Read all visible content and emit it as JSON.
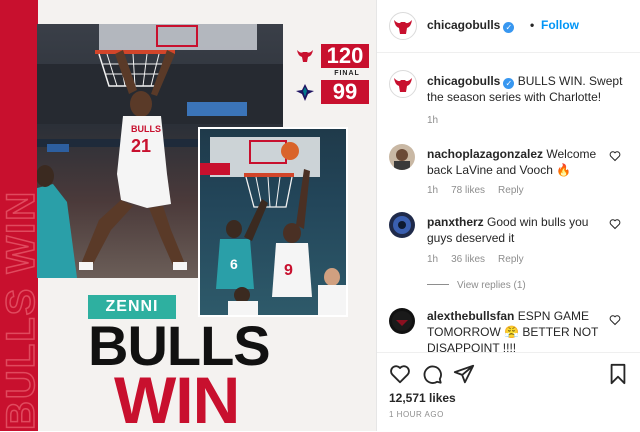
{
  "post_image": {
    "vertical_text": "BULLS WIN",
    "score": {
      "bulls": "120",
      "final_label": "FINAL",
      "opponent": "99"
    },
    "jerseys": {
      "main": "BULLS",
      "main_number": "21",
      "small_number": "9",
      "opponent_number": "6"
    },
    "sponsor": "ZENNI",
    "headline_top": "BULLS",
    "headline_bottom": "WIN",
    "colors": {
      "bulls_red": "#c8102e",
      "sponsor_teal": "#2eb0a0"
    }
  },
  "header": {
    "username": "chicagobulls",
    "separator": "•",
    "follow_label": "Follow"
  },
  "caption": {
    "username": "chicagobulls",
    "text": "BULLS WIN. Swept the season series with Charlotte!",
    "time": "1h"
  },
  "comments": [
    {
      "username": "nachoplazagonzalez",
      "text": "Welcome back LaVine and Vooch 🔥",
      "time": "1h",
      "likes": "78 likes",
      "reply": "Reply"
    },
    {
      "username": "panxtherz",
      "text": "Good win bulls you guys deserved it",
      "time": "1h",
      "likes": "36 likes",
      "reply": "Reply",
      "view_replies": "View replies (1)"
    },
    {
      "username": "alexthebullsfan",
      "text": "ESPN GAME TOMORROW 😤 BETTER NOT DISAPPOINT !!!!",
      "time": "",
      "likes": "",
      "reply": ""
    }
  ],
  "actions": {
    "icons": [
      "heart-icon",
      "comment-icon",
      "share-icon",
      "bookmark-icon"
    ],
    "likes": "12,571 likes",
    "timestamp": "1 HOUR AGO"
  },
  "colors": {
    "link_blue": "#0095f6",
    "verified_blue": "#3897f0",
    "text": "#262626",
    "muted": "#8e8e8e"
  }
}
